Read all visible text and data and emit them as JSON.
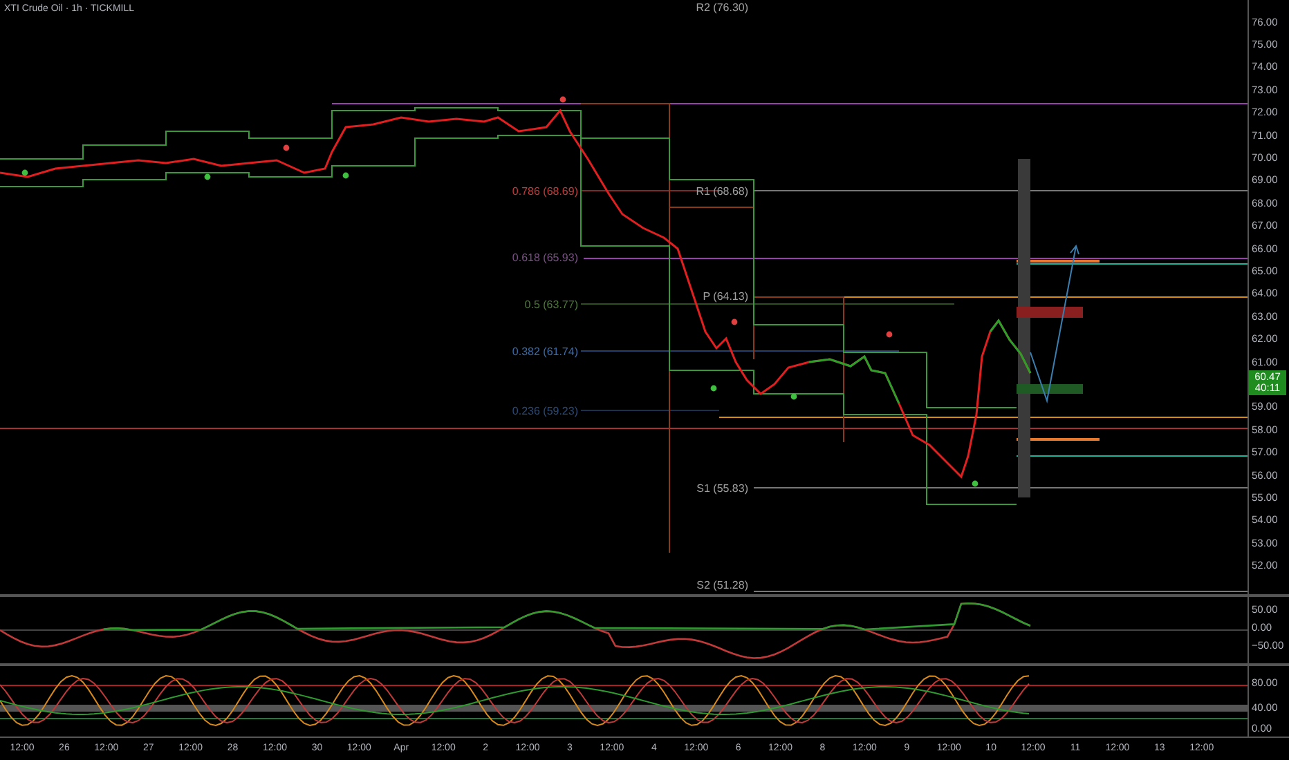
{
  "chart": {
    "title": "XTI Crude Oil · 1h · TICKMILL",
    "level_labels": [
      {
        "text": "R2 (76.30)",
        "kind": "pivot"
      },
      {
        "text": "0.786 (68.69)",
        "kind": "fib",
        "color": "#c03a3a"
      },
      {
        "text": "R1 (68.68)",
        "kind": "pivot"
      },
      {
        "text": "0.618 (65.93)",
        "kind": "fib",
        "color": "#7a4f86"
      },
      {
        "text": "P (64.13)",
        "kind": "pivot"
      },
      {
        "text": "0.5 (63.77)",
        "kind": "fib",
        "color": "#4c7a36"
      },
      {
        "text": "0.382 (61.74)",
        "kind": "fib",
        "color": "#3a6aa6"
      },
      {
        "text": "0.236 (59.23)",
        "kind": "fib",
        "color": "#2a4a78"
      },
      {
        "text": "S1 (55.83)",
        "kind": "pivot"
      },
      {
        "text": "S2 (51.28)",
        "kind": "pivot"
      }
    ],
    "price_axis": {
      "labels": [
        "76.00",
        "75.00",
        "74.00",
        "73.00",
        "72.00",
        "71.00",
        "70.00",
        "69.00",
        "68.00",
        "67.00",
        "66.00",
        "65.00",
        "64.00",
        "63.00",
        "62.00",
        "61.00",
        "59.00",
        "58.00",
        "57.00",
        "56.00",
        "55.00",
        "54.00",
        "53.00",
        "52.00"
      ]
    },
    "last_price": {
      "price": "60.47",
      "countdown": "40:11"
    }
  },
  "oscillator": {
    "axis_labels": [
      "50.00",
      "0.00",
      "−50.00"
    ]
  },
  "stochastic": {
    "axis_labels": [
      "80.00",
      "40.00",
      "0.00"
    ]
  },
  "time_axis": {
    "labels": [
      "12:00",
      "26",
      "12:00",
      "27",
      "12:00",
      "28",
      "12:00",
      "30",
      "12:00",
      "Apr",
      "12:00",
      "2",
      "12:00",
      "3",
      "12:00",
      "4",
      "12:00",
      "6",
      "12:00",
      "8",
      "12:00",
      "9",
      "12:00",
      "10",
      "12:00",
      "11",
      "12:00",
      "13",
      "12:00"
    ]
  }
}
